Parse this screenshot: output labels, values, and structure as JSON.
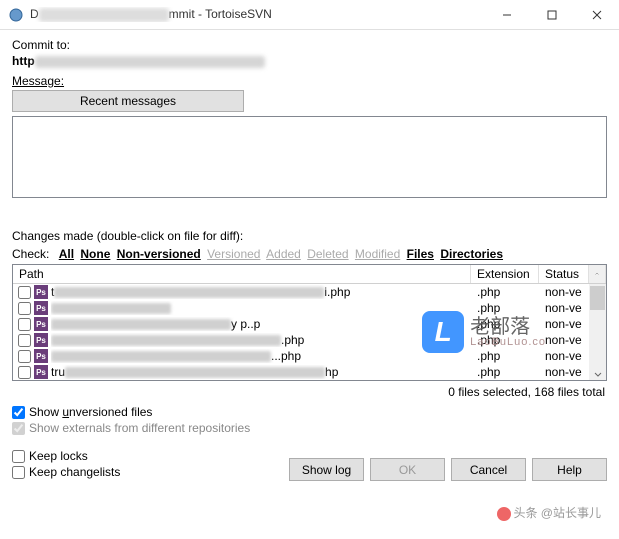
{
  "window": {
    "title_prefix": "D",
    "title_suffix": "mmit - TortoiseSVN"
  },
  "commit": {
    "label": "Commit to:",
    "url_prefix": "http"
  },
  "message": {
    "label": "Message:",
    "recent_btn": "Recent messages",
    "value": ""
  },
  "changes": {
    "label": "Changes made (double-click on file for diff):",
    "check_label": "Check:",
    "filters": {
      "all": "All",
      "none": "None",
      "nonversioned": "Non-versioned",
      "versioned": "Versioned",
      "added": "Added",
      "deleted": "Deleted",
      "modified": "Modified",
      "files": "Files",
      "directories": "Directories"
    },
    "columns": {
      "path": "Path",
      "ext": "Extension",
      "status": "Status"
    },
    "rows": [
      {
        "name_prefix": "tru",
        "name_suffix": "hp",
        "ext": ".php",
        "status": "non-ve",
        "blur_w": 260
      },
      {
        "name_prefix": "",
        "name_suffix": "...php",
        "ext": ".php",
        "status": "non-ve",
        "blur_w": 220
      },
      {
        "name_prefix": "",
        "name_suffix": ".php",
        "ext": ".php",
        "status": "non-ve",
        "blur_w": 230
      },
      {
        "name_prefix": "",
        "name_suffix": "y p..p",
        "ext": ".php",
        "status": "non-ve",
        "blur_w": 180
      },
      {
        "name_prefix": "",
        "name_suffix": "",
        "ext": ".php",
        "status": "non-ve",
        "blur_w": 120
      },
      {
        "name_prefix": "t",
        "name_suffix": "i.php",
        "ext": ".php",
        "status": "non-ve",
        "blur_w": 270
      }
    ],
    "status_line": "0 files selected, 168 files total"
  },
  "options": {
    "show_unversioned": "Show unversioned files",
    "show_externals": "Show externals from different repositories",
    "keep_locks": "Keep locks",
    "keep_changelists": "Keep changelists"
  },
  "buttons": {
    "show_log": "Show log",
    "ok": "OK",
    "cancel": "Cancel",
    "help": "Help"
  },
  "watermark": {
    "big": "老部落",
    "small": "LaoBuLuo.co"
  },
  "footer_wm": "头条 @站长事儿"
}
